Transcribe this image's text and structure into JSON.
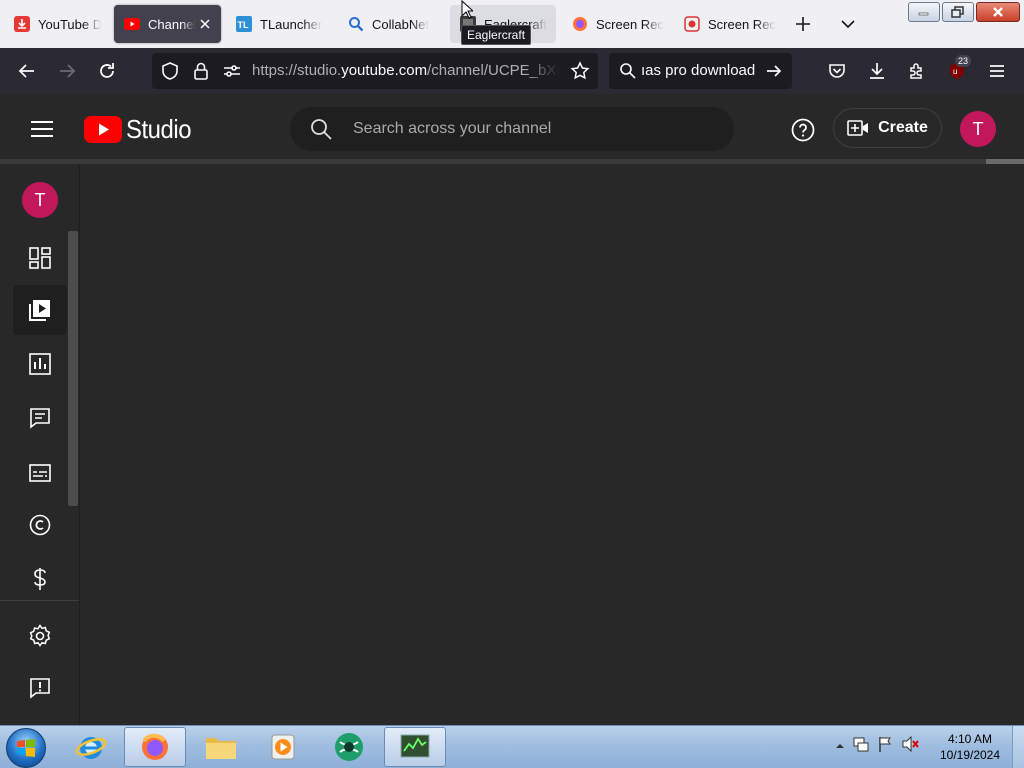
{
  "browser": {
    "tabs": [
      {
        "title": "YouTube D",
        "favicon": "download-icon",
        "state": "normal"
      },
      {
        "title": "Channel",
        "favicon": "youtube-icon",
        "state": "active"
      },
      {
        "title": "TLauncher",
        "favicon": "tlauncher-icon",
        "state": "normal"
      },
      {
        "title": "CollabNet",
        "favicon": "search-magnifier-icon",
        "state": "normal"
      },
      {
        "title": "Eaglercraft",
        "favicon": "eaglercraft-icon",
        "state": "hover"
      },
      {
        "title": "Screen Rec",
        "favicon": "firefox-icon",
        "state": "normal"
      },
      {
        "title": "Screen Rec",
        "favicon": "record-icon",
        "state": "normal"
      }
    ],
    "tooltip": "Eaglercraft",
    "url_prefix": "https://studio.",
    "url_domain": "youtube.com",
    "url_path": "/channel/UCPE_bXIm",
    "search_text": "ıas pro download",
    "extension_badge": "23",
    "accent": "#ff0000"
  },
  "studio": {
    "logo_text": "Studio",
    "search_placeholder": "Search across your channel",
    "create_label": "Create",
    "avatar_initial": "T",
    "sidebar_avatar_initial": "T",
    "sidebar_items": [
      {
        "name": "dashboard",
        "icon": "dashboard-icon"
      },
      {
        "name": "content",
        "icon": "content-icon",
        "active": true
      },
      {
        "name": "analytics",
        "icon": "analytics-icon"
      },
      {
        "name": "comments",
        "icon": "comments-icon"
      },
      {
        "name": "subtitles",
        "icon": "subtitles-icon"
      },
      {
        "name": "copyright",
        "icon": "copyright-icon"
      },
      {
        "name": "earn",
        "icon": "dollar-icon"
      },
      {
        "name": "settings",
        "icon": "gear-icon"
      },
      {
        "name": "feedback",
        "icon": "feedback-icon"
      }
    ]
  },
  "taskbar": {
    "apps": [
      "internet-explorer",
      "firefox",
      "file-explorer",
      "media-player",
      "browser-globe",
      "task-manager"
    ],
    "time": "4:10 AM",
    "date": "10/19/2024"
  }
}
